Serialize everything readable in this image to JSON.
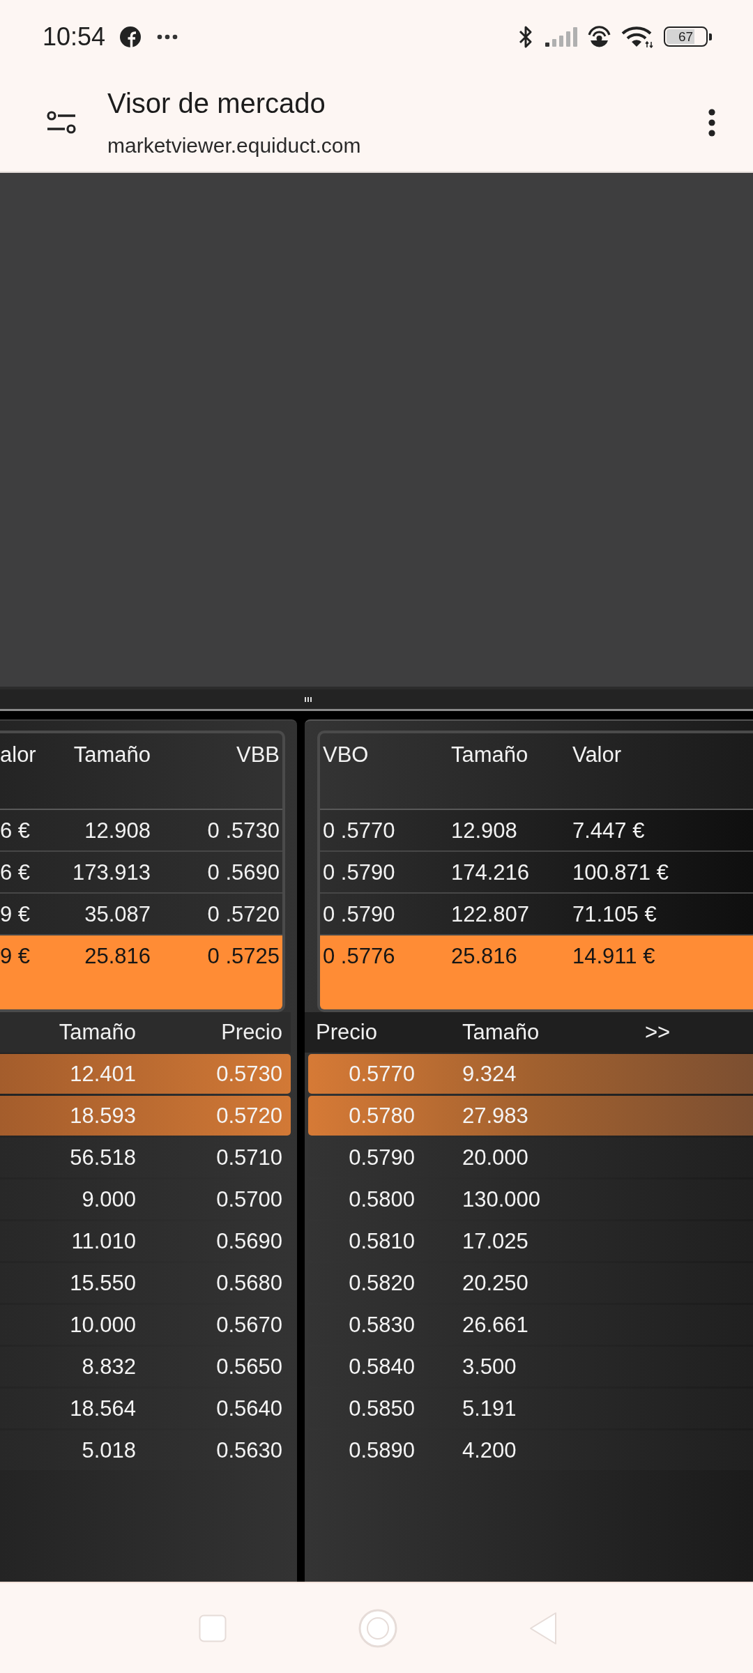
{
  "status_bar": {
    "time": "10:54",
    "battery": "67"
  },
  "browser_bar": {
    "title": "Visor de mercado",
    "url": "marketviewer.equiduct.com"
  },
  "quotes": {
    "bid": {
      "columns": [
        "alor",
        "Tamaño",
        "VBB"
      ],
      "rows": [
        {
          "cells": [
            "6 €",
            "12.908",
            "0 .5730"
          ],
          "highlighted": false
        },
        {
          "cells": [
            "6 €",
            "173.913",
            "0 .5690"
          ],
          "highlighted": false
        },
        {
          "cells": [
            "9 €",
            "35.087",
            "0 .5720"
          ],
          "highlighted": false
        },
        {
          "cells": [
            "9 €",
            "25.816",
            "0 .5725"
          ],
          "highlighted": true
        }
      ]
    },
    "offer": {
      "columns": [
        "VBO",
        "Tamaño",
        "Valor"
      ],
      "rows": [
        {
          "cells": [
            "0 .5770",
            "12.908",
            "7.447 €"
          ],
          "highlighted": false
        },
        {
          "cells": [
            "0 .5790",
            "174.216",
            "100.871 €"
          ],
          "highlighted": false
        },
        {
          "cells": [
            "0 .5790",
            "122.807",
            "71.105 €"
          ],
          "highlighted": false
        },
        {
          "cells": [
            "0 .5776",
            "25.816",
            "14.911 €"
          ],
          "highlighted": true
        }
      ]
    }
  },
  "order_book": {
    "bid": {
      "columns": [
        "Tamaño",
        "Precio"
      ],
      "rows": [
        {
          "cells": [
            "12.401",
            "0.5730"
          ],
          "highlighted": true
        },
        {
          "cells": [
            "18.593",
            "0.5720"
          ],
          "highlighted": true
        },
        {
          "cells": [
            "56.518",
            "0.5710"
          ],
          "highlighted": false
        },
        {
          "cells": [
            "9.000",
            "0.5700"
          ],
          "highlighted": false
        },
        {
          "cells": [
            "11.010",
            "0.5690"
          ],
          "highlighted": false
        },
        {
          "cells": [
            "15.550",
            "0.5680"
          ],
          "highlighted": false
        },
        {
          "cells": [
            "10.000",
            "0.5670"
          ],
          "highlighted": false
        },
        {
          "cells": [
            "8.832",
            "0.5650"
          ],
          "highlighted": false
        },
        {
          "cells": [
            "18.564",
            "0.5640"
          ],
          "highlighted": false
        },
        {
          "cells": [
            "5.018",
            "0.5630"
          ],
          "highlighted": false
        }
      ]
    },
    "ask": {
      "columns": [
        "Precio",
        "Tamaño",
        ">>"
      ],
      "rows": [
        {
          "cells": [
            "0.5770",
            "9.324"
          ],
          "highlighted": true
        },
        {
          "cells": [
            "0.5780",
            "27.983"
          ],
          "highlighted": true
        },
        {
          "cells": [
            "0.5790",
            "20.000"
          ],
          "highlighted": false
        },
        {
          "cells": [
            "0.5800",
            "130.000"
          ],
          "highlighted": false
        },
        {
          "cells": [
            "0.5810",
            "17.025"
          ],
          "highlighted": false
        },
        {
          "cells": [
            "0.5820",
            "20.250"
          ],
          "highlighted": false
        },
        {
          "cells": [
            "0.5830",
            "26.661"
          ],
          "highlighted": false
        },
        {
          "cells": [
            "0.5840",
            "3.500"
          ],
          "highlighted": false
        },
        {
          "cells": [
            "0.5850",
            "5.191"
          ],
          "highlighted": false
        },
        {
          "cells": [
            "0.5890",
            "4.200"
          ],
          "highlighted": false
        }
      ]
    }
  }
}
